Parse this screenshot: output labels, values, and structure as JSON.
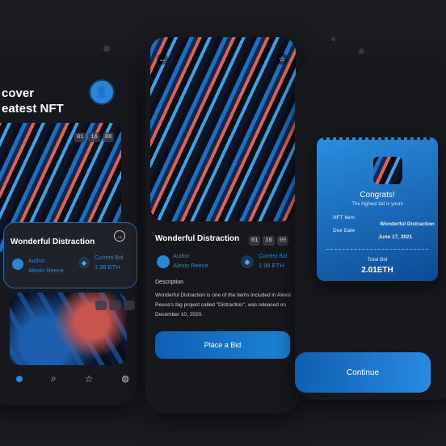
{
  "home": {
    "title_line1": "cover",
    "title_line2": "eatest NFT",
    "avatar": "👤",
    "timer": [
      "01",
      "16",
      "08"
    ],
    "card_title": "Wonderful Distraction",
    "author_label": "Author",
    "author_name": "Alexis Reece",
    "bid_label": "Current Bid",
    "bid_value": "1.98 ETH",
    "timer2": [
      "",
      "",
      ""
    ],
    "nav_icons": [
      "home-icon",
      "search-icon",
      "star-icon",
      "bag-icon"
    ]
  },
  "detail": {
    "title": "Wonderful Distraction",
    "timer": [
      "01",
      "16",
      "09"
    ],
    "author_label": "Author",
    "author_name": "Alexis Reece",
    "bid_label": "Current Bid",
    "bid_value": "1.98 ETH",
    "description_heading": "Description",
    "description": "Wonderful Distraction is one of the items included in Alexis Reece's big project called \"Distraction\", was released on December 10, 2020.",
    "button": "Place a Bid"
  },
  "congrats": {
    "title": "Congrats!",
    "subtitle": "The highest bid is yours",
    "item_label": "NFT Item",
    "item_value": "Wonderful Distraction",
    "date_label": "Due Date",
    "date_value": "June 17, 2021",
    "total_label": "Total Bid",
    "total_value": "2.01ETH",
    "button": "Continue"
  },
  "colors": {
    "background": "#1b1c1f",
    "accent": "#1b85d6",
    "card": "#17181b"
  }
}
